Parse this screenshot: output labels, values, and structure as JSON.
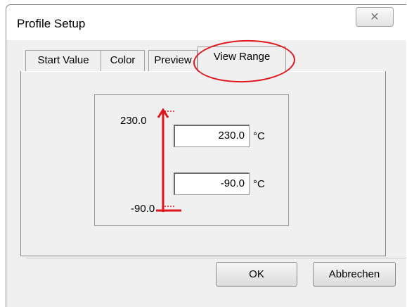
{
  "window": {
    "title": "Profile Setup",
    "close_label": "☒"
  },
  "tabs": [
    {
      "label": "Start Value",
      "active": false
    },
    {
      "label": "Color",
      "active": false
    },
    {
      "label": "Preview",
      "active": false
    },
    {
      "label": "View Range",
      "active": true
    }
  ],
  "view_range": {
    "max_label": "230.0",
    "min_label": "-90.0",
    "max_value": "230.0",
    "min_value": "-90.0",
    "unit": "°C"
  },
  "buttons": {
    "ok": "OK",
    "cancel": "Abbrechen"
  },
  "colors": {
    "annotation_red": "#e2141b",
    "dialog_bg": "#f0f0f0"
  }
}
